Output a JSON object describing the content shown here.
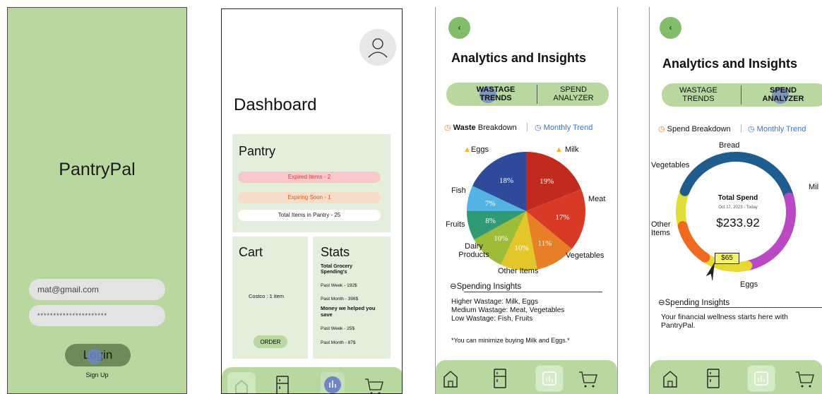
{
  "login": {
    "brand": "PantryPal",
    "email_value": "mat@gmail.com",
    "password_value": "**********************",
    "login_label": "Login",
    "signup_label": "Sign Up"
  },
  "dashboard": {
    "title": "Dashboard",
    "pantry": {
      "title": "Pantry",
      "expired": "Expired Items - 2",
      "expiring": "Expiring Soon - 1",
      "total": "Total Items in Pantry - 25"
    },
    "cart": {
      "title": "Cart",
      "item": "Costco : 1 item",
      "order_label": "ORDER"
    },
    "stats": {
      "title": "Stats",
      "spend_heading": "Total Grocery Spending's",
      "past_week_spend": "Past Week - 192$",
      "past_month_spend": "Past Month - 398$",
      "save_heading": "Money we helped you save",
      "past_week_save": "Past Week - 25$",
      "past_month_save": "Past Month - 87$"
    }
  },
  "wastage": {
    "title": "Analytics and Insights",
    "tabs": [
      "WASTAGE\nTRENDS",
      "SPEND\nANALYZER"
    ],
    "breakdown_label": "Waste",
    "breakdown_rest": " Breakdown",
    "trend_label": "Monthly Trend",
    "chart_data": {
      "type": "pie",
      "categories": [
        "Milk",
        "Meat",
        "Vegetables",
        "Other Items",
        "Dairy Products",
        "Fruits",
        "Fish",
        "Eggs"
      ],
      "values": [
        19,
        17,
        11,
        10,
        10,
        8,
        7,
        18
      ],
      "labels": [
        "19%",
        "17%",
        "11%",
        "10%",
        "10%",
        "8%",
        "7%",
        "18%"
      ],
      "colors": [
        "#c02a1f",
        "#d93a26",
        "#e67f27",
        "#e3c72a",
        "#9dbd39",
        "#2f9a73",
        "#53b4e3",
        "#2f4a9b"
      ],
      "warning_items": [
        "Eggs",
        "Milk"
      ]
    },
    "insights_title": "Spending Insights",
    "insights": [
      "Higher Wastage: Milk, Eggs",
      "Medium Wastage: Meat, Vegetables",
      "Low Wastage: Fish, Fruits"
    ],
    "tip": "*You can minimize buying Milk and Eggs.*"
  },
  "spend": {
    "title": "Analytics and Insights",
    "tabs": [
      "WASTAGE\nTRENDS",
      "SPEND\nANALYZER"
    ],
    "breakdown_label": "Spend Breakdown",
    "trend_label": "Monthly Trend",
    "chart_data": {
      "type": "pie",
      "categories": [
        "Bread",
        "Milk",
        "Eggs",
        "Other Items",
        "Vegetables"
      ],
      "colors": [
        "#e0df3a",
        "#1f5d8f",
        "#b94ac4",
        "#e7d834",
        "#ef6a1e"
      ],
      "center_title": "Total Spend",
      "center_date": "Oct 17, 2023 - Today",
      "center_value": "$233.92",
      "callout": "$65"
    },
    "labels": {
      "bread": "Bread",
      "vegetables": "Vegetables",
      "milk": "Mil",
      "other": "Other\nItems",
      "eggs": "Eggs"
    },
    "insights_title": "Spending Insights",
    "insight_text": "Your financial wellness starts here with PantryPal."
  }
}
